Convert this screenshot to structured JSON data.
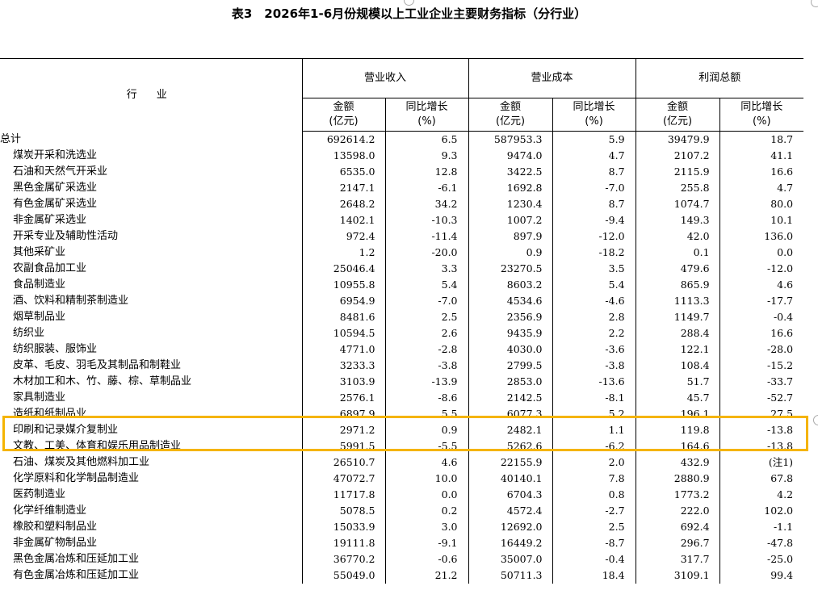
{
  "title": "表3　2026年1-6月份规模以上工业企业主要财务指标（分行业）",
  "header": {
    "industry": "行 业",
    "groups": [
      "营业收入",
      "营业成本",
      "利润总额"
    ],
    "sub": [
      {
        "line1": "金额",
        "line2": "(亿元)"
      },
      {
        "line1": "同比增长",
        "line2": "(%)"
      },
      {
        "line1": "金额",
        "line2": "(亿元)"
      },
      {
        "line1": "同比增长",
        "line2": "(%)"
      },
      {
        "line1": "金额",
        "line2": "(亿元)"
      },
      {
        "line1": "同比增长",
        "line2": "(%)"
      }
    ]
  },
  "rows": [
    {
      "name": "总计",
      "v": [
        "692614.2",
        "6.5",
        "587953.3",
        "5.9",
        "39479.9",
        "18.7"
      ],
      "total": true
    },
    {
      "name": "煤炭开采和洗选业",
      "v": [
        "13598.0",
        "9.3",
        "9474.0",
        "4.7",
        "2107.2",
        "41.1"
      ]
    },
    {
      "name": "石油和天然气开采业",
      "v": [
        "6535.0",
        "12.8",
        "3422.5",
        "8.7",
        "2115.9",
        "16.6"
      ]
    },
    {
      "name": "黑色金属矿采选业",
      "v": [
        "2147.1",
        "-6.1",
        "1692.8",
        "-7.0",
        "255.8",
        "4.7"
      ]
    },
    {
      "name": "有色金属矿采选业",
      "v": [
        "2648.2",
        "34.2",
        "1230.4",
        "8.7",
        "1074.7",
        "80.0"
      ]
    },
    {
      "name": "非金属矿采选业",
      "v": [
        "1402.1",
        "-10.3",
        "1007.2",
        "-9.4",
        "149.3",
        "10.1"
      ]
    },
    {
      "name": "开采专业及辅助性活动",
      "v": [
        "972.4",
        "-11.4",
        "897.9",
        "-12.0",
        "42.0",
        "136.0"
      ]
    },
    {
      "name": "其他采矿业",
      "v": [
        "1.2",
        "-20.0",
        "0.9",
        "-18.2",
        "0.1",
        "0.0"
      ]
    },
    {
      "name": "农副食品加工业",
      "v": [
        "25046.4",
        "3.3",
        "23270.5",
        "3.5",
        "479.6",
        "-12.0"
      ]
    },
    {
      "name": "食品制造业",
      "v": [
        "10955.8",
        "5.4",
        "8603.2",
        "5.4",
        "865.9",
        "4.6"
      ]
    },
    {
      "name": "酒、饮料和精制茶制造业",
      "v": [
        "6954.9",
        "-7.0",
        "4534.6",
        "-4.6",
        "1113.3",
        "-17.7"
      ]
    },
    {
      "name": "烟草制品业",
      "v": [
        "8481.6",
        "2.5",
        "2356.9",
        "2.8",
        "1149.7",
        "-0.4"
      ]
    },
    {
      "name": "纺织业",
      "v": [
        "10594.5",
        "2.6",
        "9435.9",
        "2.2",
        "288.4",
        "16.6"
      ]
    },
    {
      "name": "纺织服装、服饰业",
      "v": [
        "4771.0",
        "-2.8",
        "4030.0",
        "-3.6",
        "122.1",
        "-28.0"
      ]
    },
    {
      "name": "皮革、毛皮、羽毛及其制品和制鞋业",
      "v": [
        "3233.3",
        "-3.8",
        "2799.5",
        "-3.8",
        "108.4",
        "-15.2"
      ]
    },
    {
      "name": "木材加工和木、竹、藤、棕、草制品业",
      "v": [
        "3103.9",
        "-13.9",
        "2853.0",
        "-13.6",
        "51.7",
        "-33.7"
      ]
    },
    {
      "name": "家具制造业",
      "v": [
        "2576.1",
        "-8.6",
        "2142.5",
        "-8.1",
        "45.7",
        "-52.7"
      ]
    },
    {
      "name": "造纸和纸制品业",
      "v": [
        "6897.9",
        "5.5",
        "6077.3",
        "5.2",
        "196.1",
        "27.5"
      ]
    },
    {
      "name": "印刷和记录媒介复制业",
      "v": [
        "2971.2",
        "0.9",
        "2482.1",
        "1.1",
        "119.8",
        "-13.8"
      ]
    },
    {
      "name": "文教、工美、体育和娱乐用品制造业",
      "v": [
        "5991.5",
        "-5.5",
        "5262.6",
        "-6.2",
        "164.6",
        "-13.8"
      ]
    },
    {
      "name": "石油、煤炭及其他燃料加工业",
      "v": [
        "26510.7",
        "4.6",
        "22155.9",
        "2.0",
        "432.9",
        "(注1)"
      ]
    },
    {
      "name": "化学原料和化学制品制造业",
      "v": [
        "47072.7",
        "10.0",
        "40140.1",
        "7.8",
        "2880.9",
        "67.8"
      ]
    },
    {
      "name": "医药制造业",
      "v": [
        "11717.8",
        "0.0",
        "6704.3",
        "0.8",
        "1773.2",
        "4.2"
      ]
    },
    {
      "name": "化学纤维制造业",
      "v": [
        "5078.5",
        "0.2",
        "4572.4",
        "-2.7",
        "222.0",
        "102.0"
      ]
    },
    {
      "name": "橡胶和塑料制品业",
      "v": [
        "15033.9",
        "3.0",
        "12692.0",
        "2.5",
        "692.4",
        "-1.1"
      ]
    },
    {
      "name": "非金属矿物制品业",
      "v": [
        "19111.8",
        "-9.1",
        "16449.2",
        "-8.7",
        "296.7",
        "-47.8"
      ]
    },
    {
      "name": "黑色金属冶炼和压延加工业",
      "v": [
        "36770.2",
        "-0.6",
        "35007.0",
        "-0.4",
        "317.7",
        "-25.0"
      ]
    },
    {
      "name": "有色金属冶炼和压延加工业",
      "v": [
        "55049.0",
        "21.2",
        "50711.3",
        "18.4",
        "3109.1",
        "99.4"
      ]
    }
  ],
  "highlight": {
    "color": "#f5b400",
    "rows": [
      "造纸和纸制品业",
      "印刷和记录媒介复制业"
    ]
  }
}
